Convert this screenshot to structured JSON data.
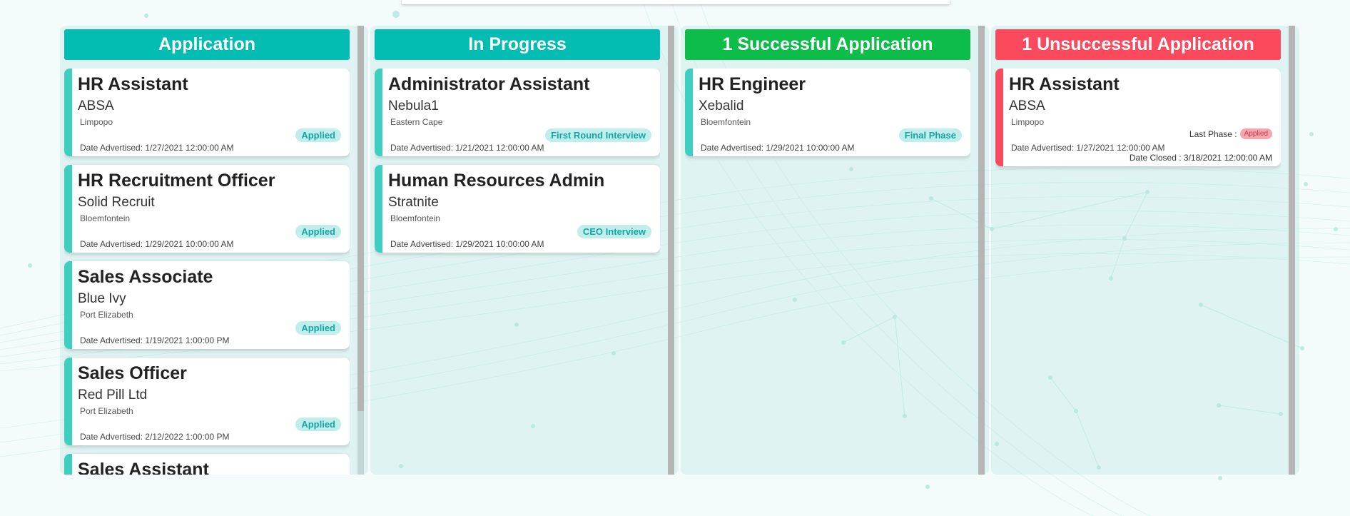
{
  "colors": {
    "teal": "#03bdb3",
    "green": "#0cbd4a",
    "red": "#fb4a5d",
    "card_accent": "#3fcfc0"
  },
  "columns": [
    {
      "header": "Application",
      "cards": [
        {
          "title": "HR Assistant",
          "company": "ABSA",
          "location": "Limpopo",
          "status": "Applied",
          "date": "Date Advertised: 1/27/2021 12:00:00 AM"
        },
        {
          "title": "HR Recruitment Officer",
          "company": "Solid Recruit",
          "location": "Bloemfontein",
          "status": "Applied",
          "date": "Date Advertised: 1/29/2021 10:00:00 AM"
        },
        {
          "title": "Sales Associate",
          "company": "Blue Ivy",
          "location": "Port Elizabeth",
          "status": "Applied",
          "date": "Date Advertised: 1/19/2021 1:00:00 PM"
        },
        {
          "title": "Sales Officer",
          "company": "Red Pill Ltd",
          "location": "Port Elizabeth",
          "status": "Applied",
          "date": "Date Advertised: 2/12/2022 1:00:00 PM"
        },
        {
          "title": "Sales Assistant"
        }
      ]
    },
    {
      "header": "In Progress",
      "cards": [
        {
          "title": "Administrator Assistant",
          "company": "Nebula1",
          "location": "Eastern Cape",
          "status": "First Round Interview",
          "date": "Date Advertised: 1/21/2021 12:00:00 AM"
        },
        {
          "title": "Human Resources Admin",
          "company": "Stratnite",
          "location": "Bloemfontein",
          "status": "CEO Interview",
          "date": "Date Advertised: 1/29/2021 10:00:00 AM"
        }
      ]
    },
    {
      "header": "1 Successful Application",
      "cards": [
        {
          "title": "HR Engineer",
          "company": "Xebalid",
          "location": "Bloemfontein",
          "status": "Final Phase",
          "date": "Date Advertised: 1/29/2021 10:00:00 AM"
        }
      ]
    },
    {
      "header": "1 Unsuccessful Application",
      "cards": [
        {
          "title": "HR Assistant",
          "company": "ABSA",
          "location": "Limpopo",
          "last_phase_label": "Last Phase :",
          "last_phase": "Applied",
          "date": "Date Advertised: 1/27/2021 12:00:00 AM",
          "date_closed": "Date Closed : 3/18/2021 12:00:00 AM"
        }
      ]
    }
  ]
}
